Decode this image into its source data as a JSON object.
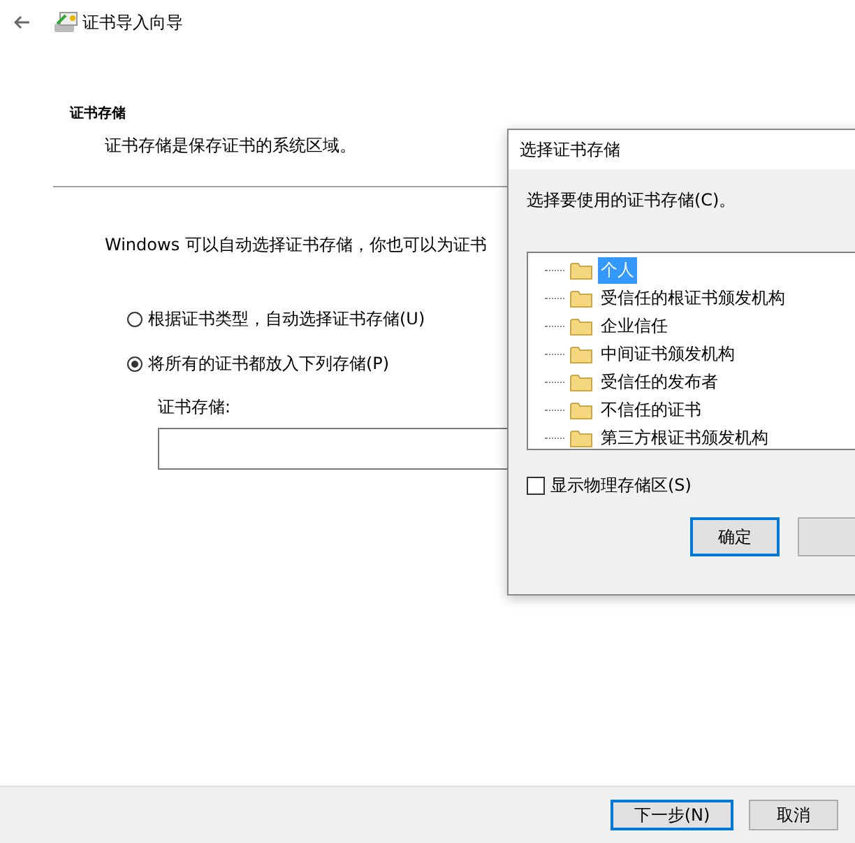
{
  "wizard": {
    "title": "证书导入向导",
    "section_title": "证书存储",
    "section_description": "证书存储是保存证书的系统区域。",
    "intro": "Windows 可以自动选择证书存储，你也可以为证书",
    "options": [
      {
        "label": "根据证书类型，自动选择证书存储(U)",
        "selected": false
      },
      {
        "label": "将所有的证书都放入下列存储(P)",
        "selected": true
      }
    ],
    "store_label": "证书存储:",
    "buttons": [
      {
        "label": "下一步(N)",
        "default": true
      },
      {
        "label": "取消",
        "default": false
      }
    ]
  },
  "dialog": {
    "title": "选择证书存储",
    "prompt": "选择要使用的证书存储(C)。",
    "stores": [
      {
        "label": "个人",
        "selected": true
      },
      {
        "label": "受信任的根证书颁发机构",
        "selected": false
      },
      {
        "label": "企业信任",
        "selected": false
      },
      {
        "label": "中间证书颁发机构",
        "selected": false
      },
      {
        "label": "受信任的发布者",
        "selected": false
      },
      {
        "label": "不信任的证书",
        "selected": false
      },
      {
        "label": "第三方根证书颁发机构",
        "selected": false
      }
    ],
    "show_physical": {
      "label": "显示物理存储区(S)",
      "checked": false
    },
    "buttons": [
      {
        "label": "确定",
        "default": true
      }
    ]
  }
}
